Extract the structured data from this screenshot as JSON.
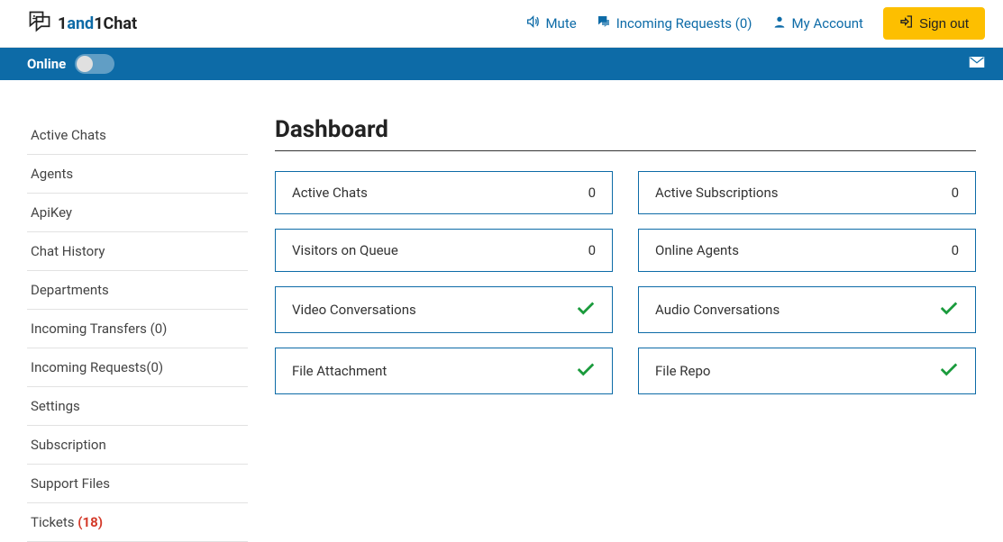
{
  "brand": {
    "part1": "1",
    "part2": "and",
    "part3": "1",
    "part4": "Chat"
  },
  "topnav": {
    "mute": "Mute",
    "incoming": "Incoming Requests (0)",
    "account": "My Account",
    "signout": "Sign out"
  },
  "statusbar": {
    "label": "Online"
  },
  "sidebar": {
    "items": [
      {
        "label": "Active Chats"
      },
      {
        "label": "Agents"
      },
      {
        "label": "ApiKey"
      },
      {
        "label": "Chat History"
      },
      {
        "label": "Departments"
      },
      {
        "label": "Incoming Transfers (0)"
      },
      {
        "label": "Incoming Requests(0)"
      },
      {
        "label": "Settings"
      },
      {
        "label": "Subscription"
      },
      {
        "label": "Support Files"
      },
      {
        "label": "Tickets ",
        "badge": "(18)"
      }
    ]
  },
  "page": {
    "title": "Dashboard"
  },
  "cards": {
    "activeChats": {
      "label": "Active Chats",
      "value": "0"
    },
    "activeSubs": {
      "label": "Active Subscriptions",
      "value": "0"
    },
    "visitorsQueue": {
      "label": "Visitors on Queue",
      "value": "0"
    },
    "onlineAgents": {
      "label": "Online Agents",
      "value": "0"
    },
    "videoConv": {
      "label": "Video Conversations"
    },
    "audioConv": {
      "label": "Audio Conversations"
    },
    "fileAttach": {
      "label": "File Attachment"
    },
    "fileRepo": {
      "label": "File Repo"
    }
  }
}
